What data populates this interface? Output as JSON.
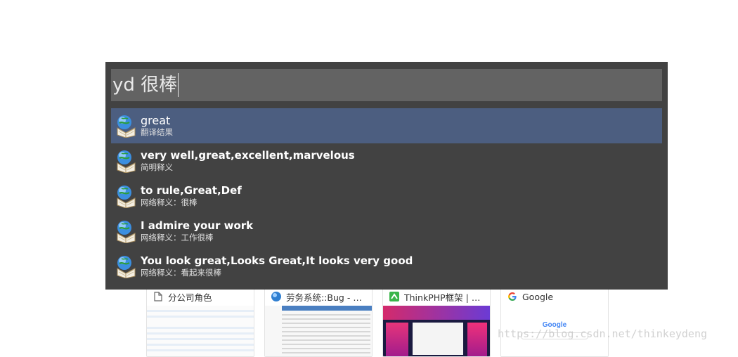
{
  "launcher": {
    "query": "yd 很棒",
    "results": [
      {
        "title": "great",
        "subtitle": "翻译结果",
        "icon": "dictionary-globe-icon"
      },
      {
        "title": "very well,great,excellent,marvelous",
        "subtitle": "简明释义",
        "icon": "dictionary-globe-icon"
      },
      {
        "title": "to rule,Great,Def",
        "subtitle": "网络释义：很棒",
        "icon": "dictionary-globe-icon"
      },
      {
        "title": "I admire your work",
        "subtitle": "网络释义：工作很棒",
        "icon": "dictionary-globe-icon"
      },
      {
        "title": "You look great,Looks Great,It looks very good",
        "subtitle": "网络释义：看起来很棒",
        "icon": "dictionary-globe-icon"
      }
    ]
  },
  "tiles": [
    {
      "title": "分公司角色",
      "icon": "page-icon"
    },
    {
      "title": "劳务系统::Bug - 禅道",
      "icon": "zentao-icon"
    },
    {
      "title": "ThinkPHP框架 | 中…",
      "icon": "thinkphp-icon"
    },
    {
      "title": "Google",
      "icon": "google-icon"
    }
  ],
  "watermark": "https://blog.csdn.net/thinkeydeng",
  "google_thumb_word": "Google",
  "colors": {
    "launcher_bg": "#424242",
    "query_bg": "#636363",
    "selected_bg": "#4c5e80"
  }
}
